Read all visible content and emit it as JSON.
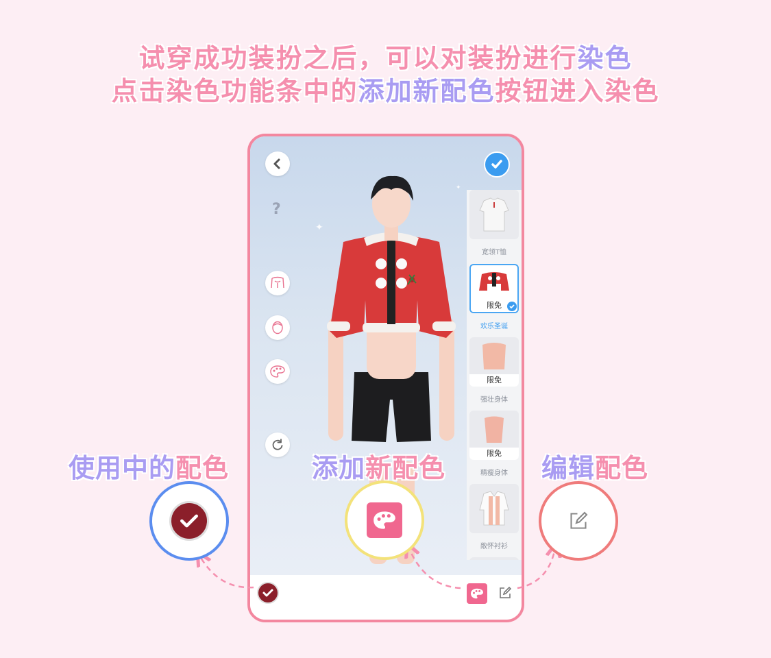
{
  "headline": {
    "line1_a": "试穿成功装扮之后，可以对装扮进行",
    "line1_b": "染色",
    "line2_a": "点击染色功能条中的",
    "line2_b": "添加新配色",
    "line2_c": "按钮进入染色"
  },
  "callouts": {
    "in_use": {
      "part1": "使用中的",
      "part2": "配色"
    },
    "add_new": {
      "part1": "添加",
      "part2": "新配色"
    },
    "edit": {
      "part1": "编辑",
      "part2": "配色"
    }
  },
  "phone": {
    "help_symbol": "?",
    "items": [
      {
        "name": "宽领T恤",
        "badge": "",
        "selected": false
      },
      {
        "name": "欢乐圣诞",
        "badge": "限免",
        "selected": true
      },
      {
        "name": "强壮身体",
        "badge": "限免",
        "selected": false
      },
      {
        "name": "精瘦身体",
        "badge": "限免",
        "selected": false
      },
      {
        "name": "敞怀衬衫",
        "badge": "",
        "selected": false
      }
    ]
  },
  "colors": {
    "headline_pink": "#f58fae",
    "headline_purple": "#a99cf2",
    "frame_pink": "#f3879f",
    "circle_blue": "#5b8def",
    "circle_yellow": "#f3e27a",
    "circle_red": "#ef7b7b",
    "swatch_darkred": "#8b1f2a",
    "palette_pink": "#f0678f",
    "confirm_blue": "#3b9cf0"
  },
  "icons": [
    "back-icon",
    "confirm-check-icon",
    "help-icon",
    "body-shape-icon",
    "face-icon",
    "palette-icon",
    "reset-icon",
    "edit-icon"
  ]
}
